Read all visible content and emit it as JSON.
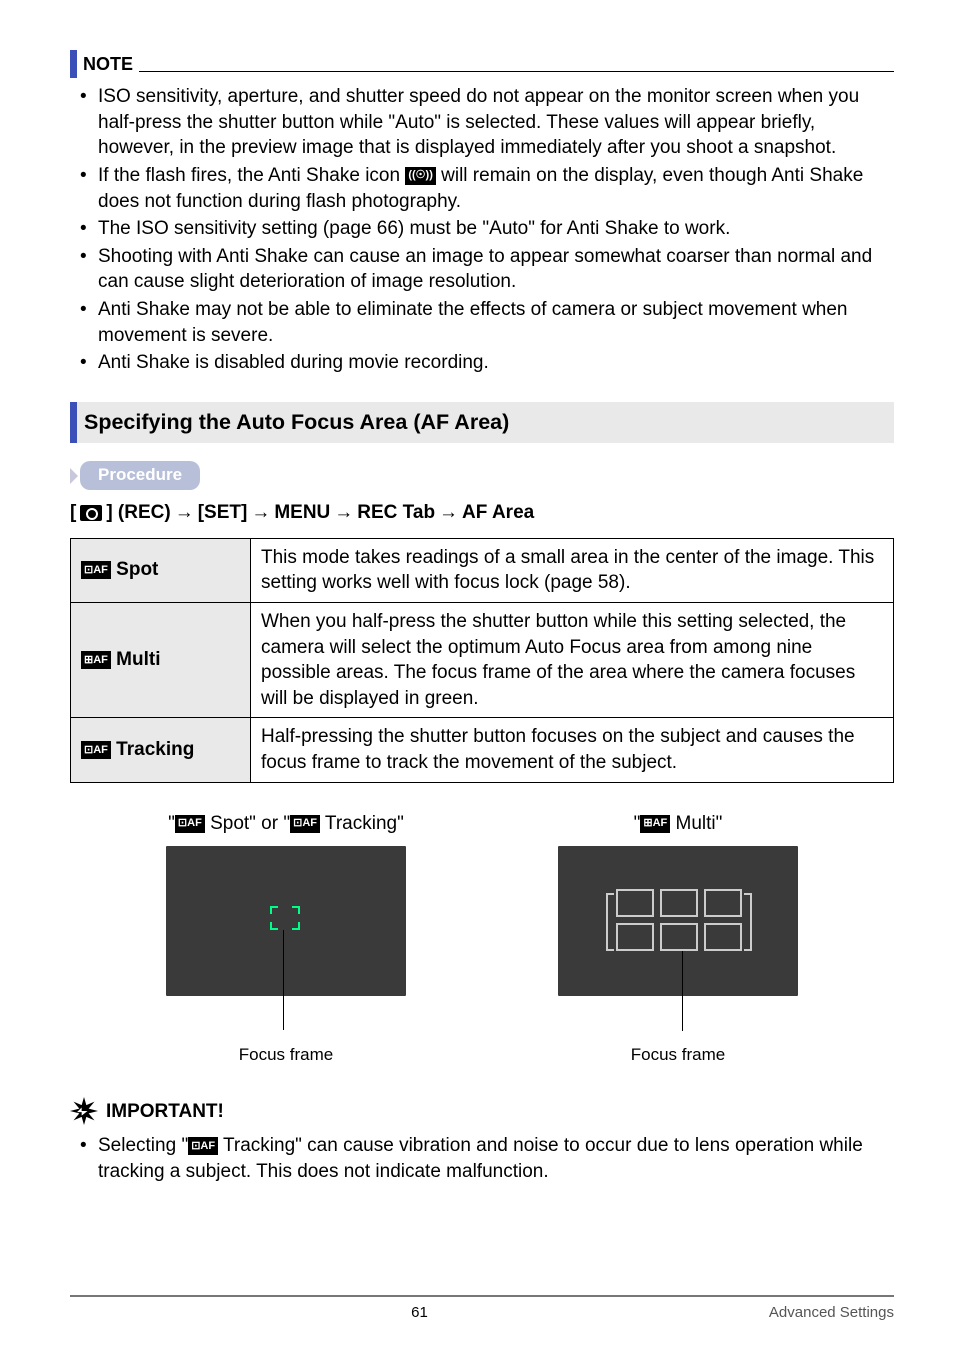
{
  "note": {
    "label": "NOTE",
    "bullets": [
      "ISO sensitivity, aperture, and shutter speed do not appear on the monitor screen when you half-press the shutter button while \"Auto\" is selected. These values will appear briefly, however, in the preview image that is displayed immediately after you shoot a snapshot.",
      "If the flash fires, the Anti Shake icon ___ICON___ will remain on the display, even though Anti Shake does not function during flash photography.",
      "The ISO sensitivity setting (page 66) must be \"Auto\" for Anti Shake to work.",
      "Shooting with Anti Shake can cause an image to appear somewhat coarser than normal and can cause slight deterioration of image resolution.",
      "Anti Shake may not be able to eliminate the effects of camera or subject movement when movement is severe.",
      "Anti Shake is disabled during movie recording."
    ],
    "antishake_icon": "((☉))"
  },
  "section": {
    "heading": "Specifying the Auto Focus Area (AF Area)"
  },
  "procedure": {
    "label": "Procedure",
    "path_parts": [
      "[",
      "] (REC)",
      "[SET]",
      "MENU",
      "REC Tab",
      "AF Area"
    ]
  },
  "table": {
    "rows": [
      {
        "icon": "⊡AF",
        "name": "Spot",
        "desc": "This mode takes readings of a small area in the center of the image. This setting works well with focus lock (page 58)."
      },
      {
        "icon": "⊞AF",
        "name": "Multi",
        "desc": "When you half-press the shutter button while this setting selected, the camera will select the optimum Auto Focus area from among nine possible areas. The focus frame of the area where the camera focuses will be displayed in green."
      },
      {
        "icon": "⊡AF",
        "name": "Tracking",
        "desc": "Half-pressing the shutter button focuses on the subject and causes the focus frame to track the movement of the subject."
      }
    ]
  },
  "previews": {
    "left_label_prefix": "\"",
    "left_spot": " Spot\" or \"",
    "left_tracking": " Tracking\"",
    "right_label_prefix": "\"",
    "right_multi": " Multi\"",
    "focus_frame": "Focus frame"
  },
  "important": {
    "label": "IMPORTANT!",
    "text_pre": "Selecting \"",
    "text_post": " Tracking\" can cause vibration and noise to occur due to lens operation while tracking a subject. This does not indicate malfunction."
  },
  "footer": {
    "page": "61",
    "section": "Advanced Settings"
  }
}
